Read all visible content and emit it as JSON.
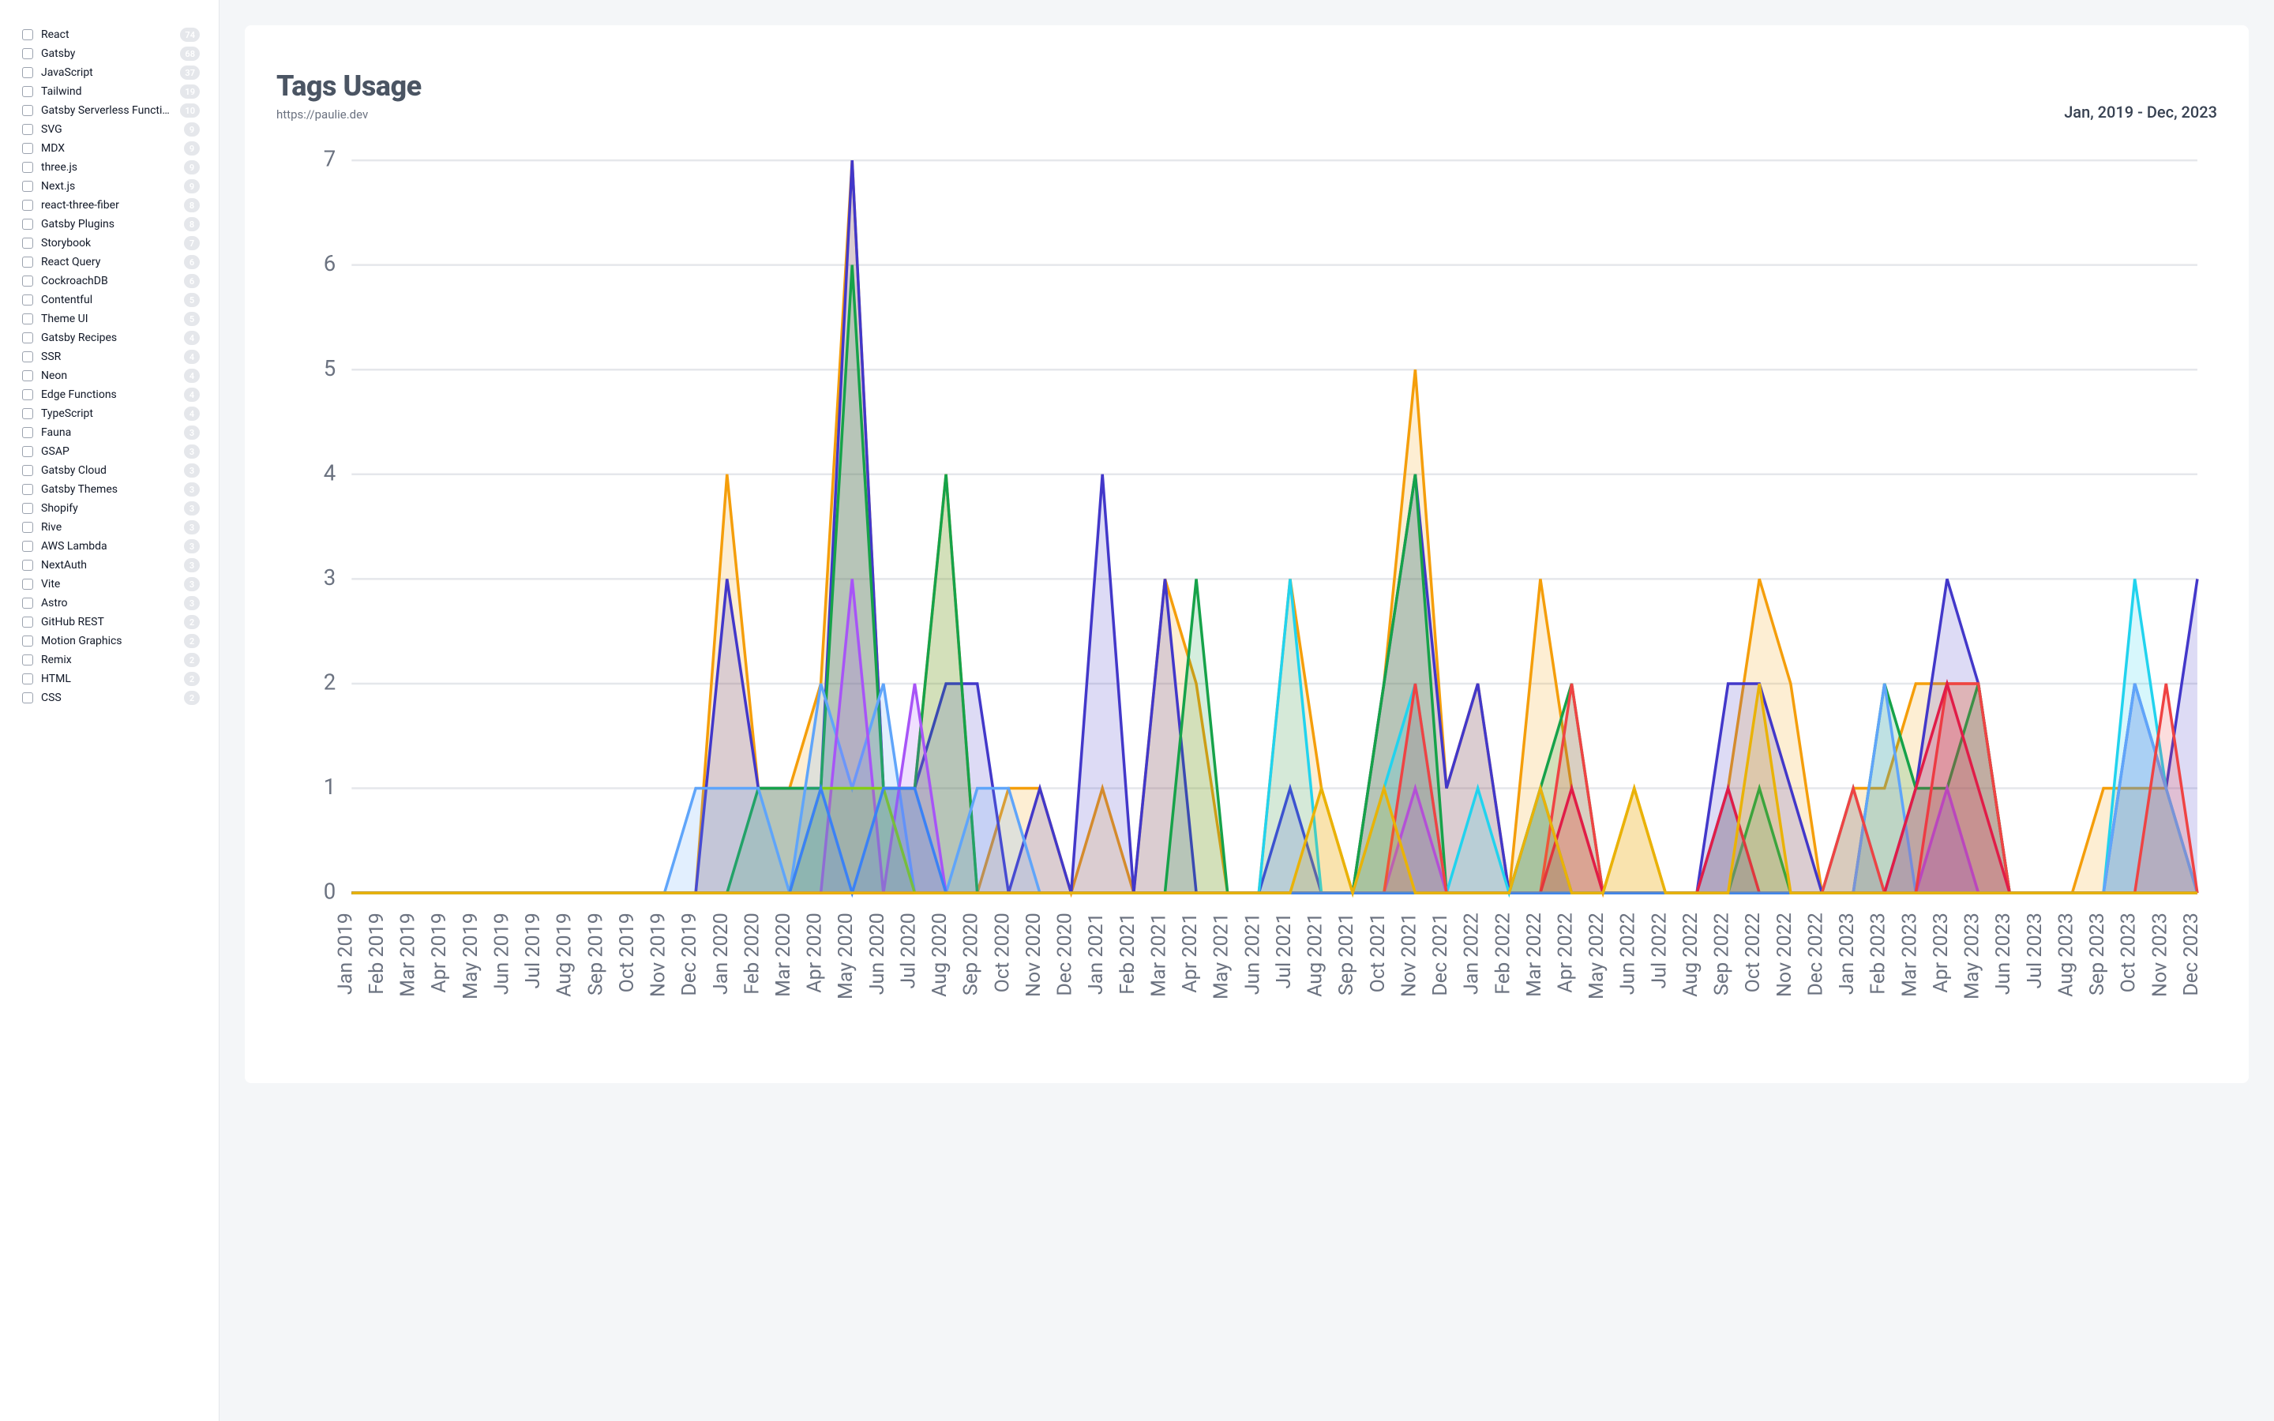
{
  "sidebar": {
    "tags": [
      {
        "label": "React",
        "count": 74
      },
      {
        "label": "Gatsby",
        "count": 68
      },
      {
        "label": "JavaScript",
        "count": 37
      },
      {
        "label": "Tailwind",
        "count": 19
      },
      {
        "label": "Gatsby Serverless Functions",
        "count": 10
      },
      {
        "label": "SVG",
        "count": 9
      },
      {
        "label": "MDX",
        "count": 9
      },
      {
        "label": "three.js",
        "count": 9
      },
      {
        "label": "Next.js",
        "count": 9
      },
      {
        "label": "react-three-fiber",
        "count": 8
      },
      {
        "label": "Gatsby Plugins",
        "count": 8
      },
      {
        "label": "Storybook",
        "count": 7
      },
      {
        "label": "React Query",
        "count": 6
      },
      {
        "label": "CockroachDB",
        "count": 6
      },
      {
        "label": "Contentful",
        "count": 5
      },
      {
        "label": "Theme UI",
        "count": 5
      },
      {
        "label": "Gatsby Recipes",
        "count": 4
      },
      {
        "label": "SSR",
        "count": 4
      },
      {
        "label": "Neon",
        "count": 4
      },
      {
        "label": "Edge Functions",
        "count": 4
      },
      {
        "label": "TypeScript",
        "count": 4
      },
      {
        "label": "Fauna",
        "count": 3
      },
      {
        "label": "GSAP",
        "count": 3
      },
      {
        "label": "Gatsby Cloud",
        "count": 3
      },
      {
        "label": "Gatsby Themes",
        "count": 3
      },
      {
        "label": "Shopify",
        "count": 3
      },
      {
        "label": "Rive",
        "count": 3
      },
      {
        "label": "AWS Lambda",
        "count": 3
      },
      {
        "label": "NextAuth",
        "count": 3
      },
      {
        "label": "Vite",
        "count": 3
      },
      {
        "label": "Astro",
        "count": 3
      },
      {
        "label": "GitHub REST",
        "count": 2
      },
      {
        "label": "Motion Graphics",
        "count": 2
      },
      {
        "label": "Remix",
        "count": 2
      },
      {
        "label": "HTML",
        "count": 2
      },
      {
        "label": "CSS",
        "count": 2
      }
    ]
  },
  "chart": {
    "title": "Tags Usage",
    "subtitle": "https://paulie.dev",
    "range": "Jan, 2019 - Dec, 2023"
  },
  "chart_data": {
    "type": "area",
    "xlabel": "",
    "ylabel": "",
    "ylim": [
      0,
      7
    ],
    "y_ticks": [
      0,
      1,
      2,
      3,
      4,
      5,
      6,
      7
    ],
    "categories": [
      "Jan 2019",
      "Feb 2019",
      "Mar 2019",
      "Apr 2019",
      "May 2019",
      "Jun 2019",
      "Jul 2019",
      "Aug 2019",
      "Sep 2019",
      "Oct 2019",
      "Nov 2019",
      "Dec 2019",
      "Jan 2020",
      "Feb 2020",
      "Mar 2020",
      "Apr 2020",
      "May 2020",
      "Jun 2020",
      "Jul 2020",
      "Aug 2020",
      "Sep 2020",
      "Oct 2020",
      "Nov 2020",
      "Dec 2020",
      "Jan 2021",
      "Feb 2021",
      "Mar 2021",
      "Apr 2021",
      "May 2021",
      "Jun 2021",
      "Jul 2021",
      "Aug 2021",
      "Sep 2021",
      "Oct 2021",
      "Nov 2021",
      "Dec 2021",
      "Jan 2022",
      "Feb 2022",
      "Mar 2022",
      "Apr 2022",
      "May 2022",
      "Jun 2022",
      "Jul 2022",
      "Aug 2022",
      "Sep 2022",
      "Oct 2022",
      "Nov 2022",
      "Dec 2022",
      "Jan 2023",
      "Feb 2023",
      "Mar 2023",
      "Apr 2023",
      "May 2023",
      "Jun 2023",
      "Jul 2023",
      "Aug 2023",
      "Sep 2023",
      "Oct 2023",
      "Nov 2023",
      "Dec 2023"
    ],
    "series": [
      {
        "name": "React",
        "color": "#f59e0b",
        "values": [
          0,
          0,
          0,
          0,
          0,
          0,
          0,
          0,
          0,
          0,
          0,
          0,
          4,
          1,
          1,
          2,
          7,
          1,
          1,
          4,
          0,
          1,
          1,
          0,
          1,
          0,
          3,
          2,
          0,
          0,
          3,
          1,
          0,
          2,
          5,
          1,
          2,
          0,
          3,
          1,
          0,
          1,
          0,
          0,
          1,
          3,
          2,
          0,
          1,
          1,
          2,
          2,
          2,
          0,
          0,
          0,
          1,
          1,
          1,
          0
        ]
      },
      {
        "name": "Gatsby",
        "color": "#4338ca",
        "values": [
          0,
          0,
          0,
          0,
          0,
          0,
          0,
          0,
          0,
          0,
          0,
          0,
          3,
          1,
          1,
          1,
          7,
          1,
          1,
          2,
          2,
          0,
          1,
          0,
          4,
          0,
          3,
          0,
          0,
          0,
          1,
          0,
          0,
          2,
          4,
          1,
          2,
          0,
          1,
          0,
          0,
          0,
          0,
          0,
          2,
          2,
          1,
          0,
          0,
          0,
          1,
          3,
          2,
          0,
          0,
          0,
          0,
          2,
          1,
          3
        ]
      },
      {
        "name": "JavaScript",
        "color": "#16a34a",
        "values": [
          0,
          0,
          0,
          0,
          0,
          0,
          0,
          0,
          0,
          0,
          0,
          0,
          0,
          1,
          1,
          1,
          6,
          1,
          1,
          4,
          0,
          0,
          0,
          0,
          0,
          0,
          0,
          3,
          0,
          0,
          0,
          0,
          0,
          2,
          4,
          0,
          0,
          0,
          1,
          2,
          0,
          0,
          0,
          0,
          0,
          1,
          0,
          0,
          0,
          2,
          1,
          1,
          2,
          0,
          0,
          0,
          0,
          0,
          0,
          0
        ]
      },
      {
        "name": "Tailwind",
        "color": "#22d3ee",
        "values": [
          0,
          0,
          0,
          0,
          0,
          0,
          0,
          0,
          0,
          0,
          0,
          0,
          0,
          0,
          0,
          0,
          0,
          0,
          0,
          0,
          0,
          0,
          0,
          0,
          0,
          0,
          0,
          0,
          0,
          0,
          3,
          0,
          0,
          1,
          2,
          0,
          1,
          0,
          1,
          0,
          0,
          0,
          0,
          0,
          1,
          0,
          0,
          0,
          1,
          0,
          0,
          0,
          0,
          0,
          0,
          0,
          0,
          3,
          1,
          0
        ]
      },
      {
        "name": "SVG",
        "color": "#60a5fa",
        "values": [
          0,
          0,
          0,
          0,
          0,
          0,
          0,
          0,
          0,
          0,
          0,
          1,
          1,
          1,
          0,
          2,
          1,
          2,
          0,
          0,
          1,
          1,
          0,
          0,
          0,
          0,
          0,
          0,
          0,
          0,
          0,
          0,
          0,
          0,
          0,
          0,
          0,
          0,
          0,
          0,
          0,
          0,
          0,
          0,
          1,
          0,
          0,
          0,
          0,
          2,
          0,
          1,
          0,
          0,
          0,
          0,
          0,
          2,
          1,
          0
        ]
      },
      {
        "name": "MDX",
        "color": "#a855f7",
        "values": [
          0,
          0,
          0,
          0,
          0,
          0,
          0,
          0,
          0,
          0,
          0,
          0,
          0,
          0,
          0,
          0,
          3,
          0,
          2,
          0,
          0,
          0,
          0,
          0,
          0,
          0,
          0,
          0,
          0,
          0,
          0,
          0,
          0,
          0,
          1,
          0,
          0,
          0,
          0,
          0,
          0,
          0,
          0,
          0,
          0,
          0,
          0,
          0,
          0,
          0,
          0,
          1,
          0,
          0,
          0,
          0,
          0,
          0,
          0,
          0
        ]
      },
      {
        "name": "three.js",
        "color": "#ef4444",
        "values": [
          0,
          0,
          0,
          0,
          0,
          0,
          0,
          0,
          0,
          0,
          0,
          0,
          0,
          0,
          0,
          0,
          0,
          0,
          0,
          0,
          0,
          0,
          0,
          0,
          0,
          0,
          0,
          0,
          0,
          0,
          0,
          0,
          0,
          0,
          2,
          0,
          0,
          0,
          0,
          2,
          0,
          0,
          0,
          0,
          0,
          0,
          0,
          0,
          1,
          0,
          0,
          2,
          2,
          0,
          0,
          0,
          0,
          0,
          2,
          0
        ]
      },
      {
        "name": "Next.js",
        "color": "#e11d48",
        "values": [
          0,
          0,
          0,
          0,
          0,
          0,
          0,
          0,
          0,
          0,
          0,
          0,
          0,
          0,
          0,
          0,
          0,
          0,
          0,
          0,
          0,
          0,
          0,
          0,
          0,
          0,
          0,
          0,
          0,
          0,
          0,
          0,
          0,
          0,
          0,
          0,
          0,
          0,
          0,
          1,
          0,
          0,
          0,
          0,
          1,
          0,
          0,
          0,
          0,
          0,
          1,
          2,
          1,
          0,
          0,
          0,
          0,
          0,
          0,
          0
        ]
      },
      {
        "name": "Storybook",
        "color": "#84cc16",
        "values": [
          0,
          0,
          0,
          0,
          0,
          0,
          0,
          0,
          0,
          0,
          0,
          0,
          0,
          0,
          0,
          1,
          1,
          1,
          0,
          0,
          0,
          0,
          0,
          0,
          0,
          0,
          0,
          0,
          0,
          0,
          0,
          0,
          0,
          0,
          0,
          0,
          0,
          0,
          0,
          0,
          0,
          0,
          0,
          0,
          0,
          0,
          0,
          0,
          0,
          0,
          0,
          0,
          0,
          0,
          0,
          0,
          0,
          0,
          0,
          0
        ]
      },
      {
        "name": "Theme UI",
        "color": "#3b82f6",
        "values": [
          0,
          0,
          0,
          0,
          0,
          0,
          0,
          0,
          0,
          0,
          0,
          0,
          0,
          0,
          0,
          1,
          0,
          1,
          1,
          0,
          0,
          0,
          0,
          0,
          0,
          0,
          0,
          0,
          0,
          0,
          0,
          0,
          0,
          0,
          0,
          0,
          0,
          0,
          0,
          0,
          0,
          0,
          0,
          0,
          0,
          0,
          0,
          0,
          0,
          0,
          0,
          0,
          0,
          0,
          0,
          0,
          0,
          0,
          0,
          0
        ]
      },
      {
        "name": "Gatsby Serverless Functions",
        "color": "#eab308",
        "values": [
          0,
          0,
          0,
          0,
          0,
          0,
          0,
          0,
          0,
          0,
          0,
          0,
          0,
          0,
          0,
          0,
          0,
          0,
          0,
          0,
          0,
          0,
          0,
          0,
          0,
          0,
          0,
          0,
          0,
          0,
          0,
          1,
          0,
          1,
          0,
          0,
          0,
          0,
          1,
          0,
          0,
          1,
          0,
          0,
          0,
          2,
          0,
          0,
          0,
          0,
          0,
          0,
          0,
          0,
          0,
          0,
          0,
          0,
          0,
          0
        ]
      }
    ]
  }
}
